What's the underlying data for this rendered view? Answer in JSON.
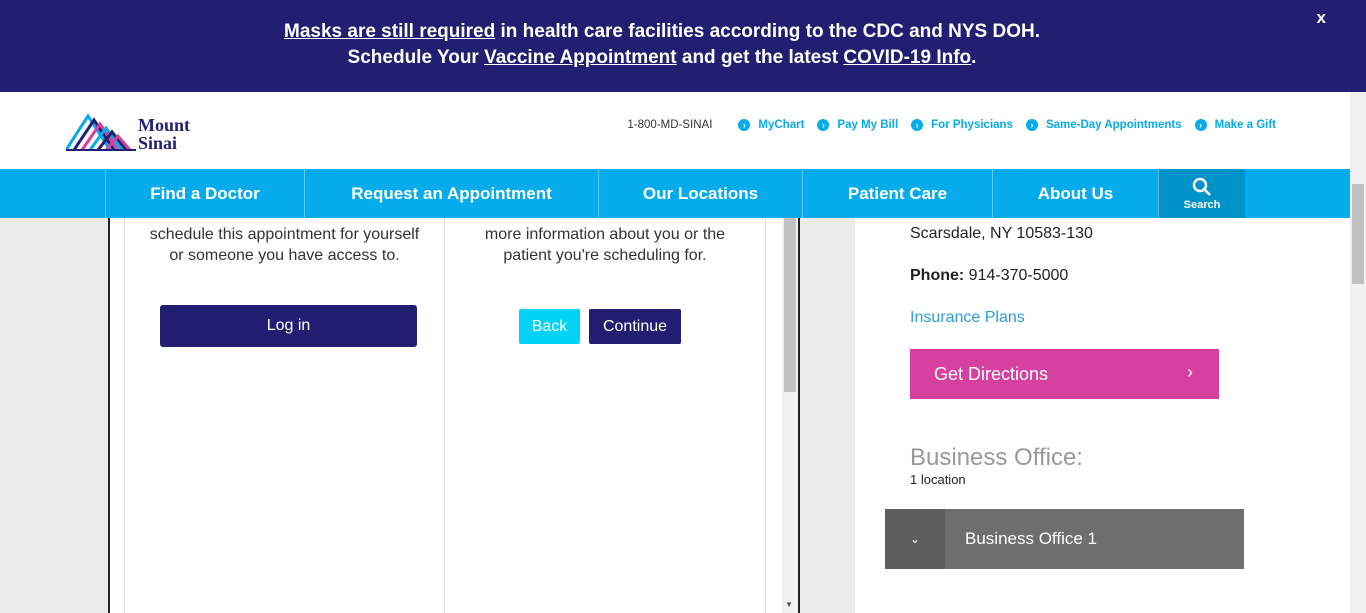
{
  "alert": {
    "line1_link": "Masks are still required",
    "line1_text": " in health care facilities according to the CDC and NYS DOH.",
    "line2_prefix": "Schedule Your ",
    "line2_link1": "Vaccine Appointment",
    "line2_mid": " and get the latest ",
    "line2_link2": "COVID-19 Info",
    "line2_suffix": ".",
    "close": "x"
  },
  "header": {
    "logo_line1": "Mount",
    "logo_line2": "Sinai",
    "phone": "1-800-MD-SINAI",
    "links": [
      "MyChart",
      "Pay My Bill",
      "For Physicians",
      "Same-Day Appointments",
      "Make a Gift"
    ]
  },
  "nav": {
    "items": [
      "Find a Doctor",
      "Request an Appointment",
      "Our Locations",
      "Patient Care",
      "About Us"
    ],
    "search": "Search"
  },
  "card": {
    "left_text_line1": "schedule this appointment for yourself",
    "left_text_line2": "or someone you have access to.",
    "login": "Log in",
    "right_text_line1": "more information about you or the",
    "right_text_line2": "patient you're scheduling for.",
    "back": "Back",
    "continue": "Continue"
  },
  "sidebar": {
    "address": "Scarsdale, NY 10583-130",
    "phone_label": "Phone:",
    "phone_value": " 914-370-5000",
    "insurance": "Insurance Plans",
    "directions": "Get Directions",
    "business_title": "Business Office:",
    "business_count": "1 location",
    "accordion_label": "Business Office 1"
  },
  "colors": {
    "brand_navy": "#221f72",
    "nav_blue": "#06abeb",
    "directions_pink": "#d6409f",
    "back_cyan": "#00d3f5"
  }
}
